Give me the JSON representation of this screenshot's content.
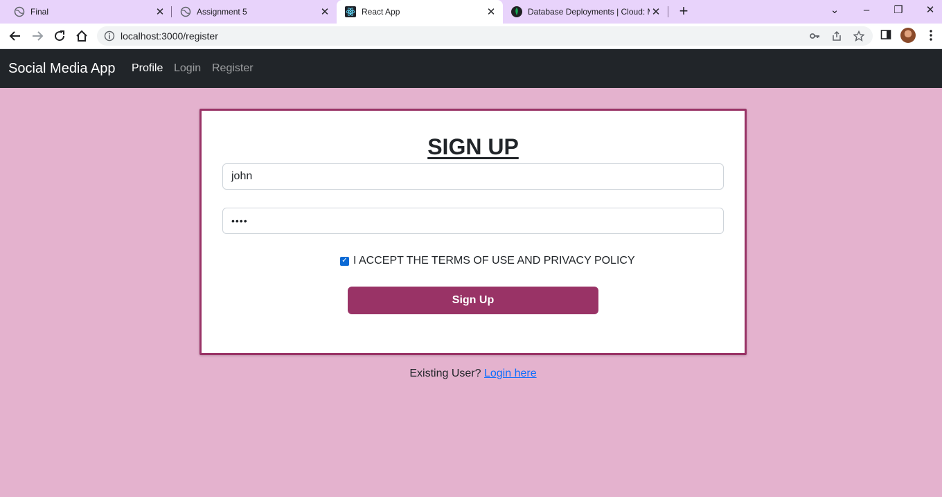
{
  "browser": {
    "tabs": [
      {
        "title": "Final",
        "active": false
      },
      {
        "title": "Assignment 5",
        "active": false
      },
      {
        "title": "React App",
        "active": true
      },
      {
        "title": "Database Deployments | Cloud: M",
        "active": false
      }
    ],
    "url": "localhost:3000/register"
  },
  "navbar": {
    "brand": "Social Media App",
    "links": [
      "Profile",
      "Login",
      "Register"
    ]
  },
  "form": {
    "title": "SIGN UP",
    "username_value": "john",
    "password_value": "••••",
    "terms_label": "I ACCEPT THE TERMS OF USE AND PRIVACY POLICY",
    "terms_checked": true,
    "submit_label": "Sign Up"
  },
  "footer": {
    "existing_text": "Existing User?",
    "login_link": "Login here"
  },
  "colors": {
    "page_bg": "#e4b2ce",
    "accent": "#993366",
    "navbar_bg": "#212529",
    "tabstrip_bg": "#e8d3fb"
  }
}
